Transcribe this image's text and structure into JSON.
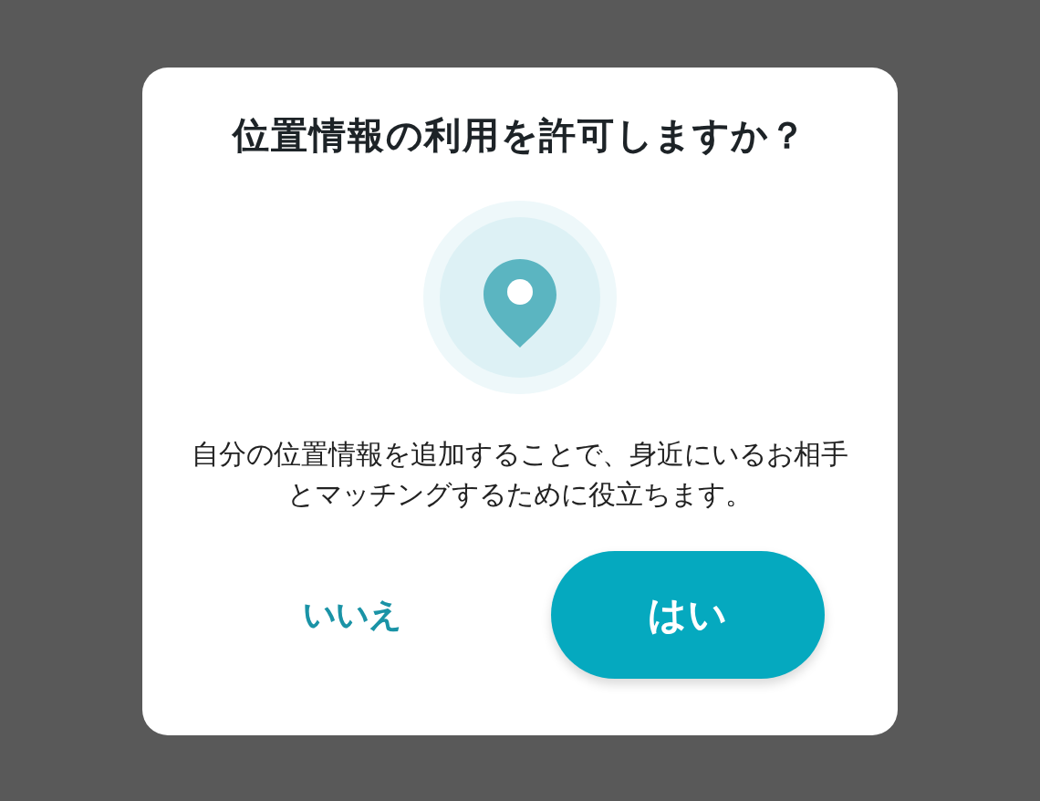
{
  "dialog": {
    "title": "位置情報の利用を許可しますか？",
    "message": "自分の位置情報を追加することで、身近にいるお相手とマッチングするために役立ちます。",
    "buttons": [
      {
        "label": "いいえ",
        "kind": "text"
      },
      {
        "label": "はい",
        "kind": "filled"
      }
    ]
  }
}
